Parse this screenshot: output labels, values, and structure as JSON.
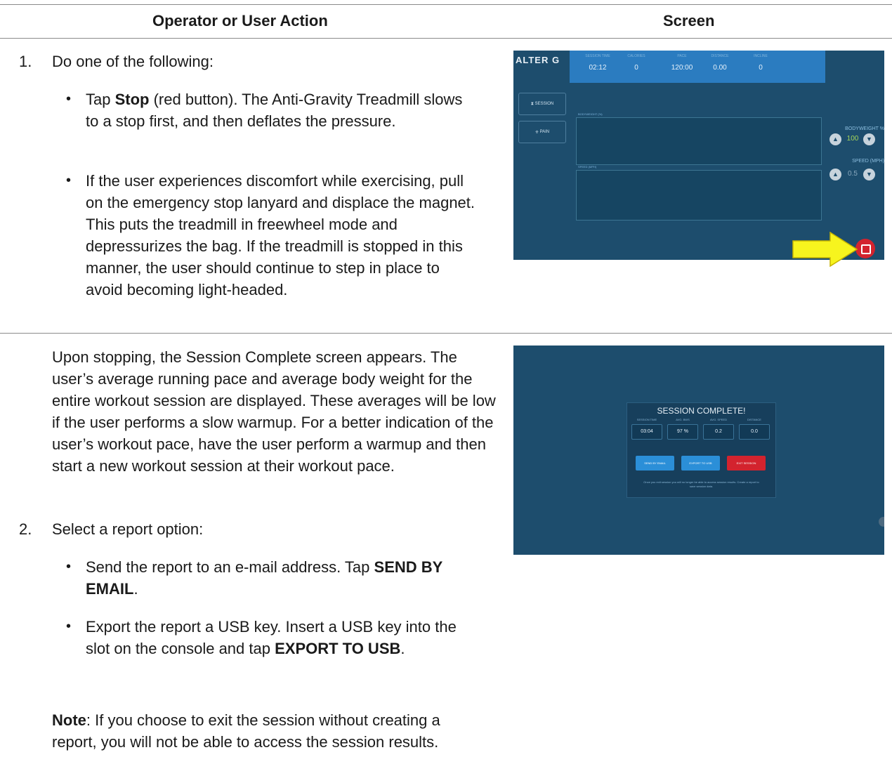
{
  "table": {
    "header_action": "Operator or User Action",
    "header_screen": "Screen"
  },
  "row1": {
    "step_num": "1.",
    "step_text": "Do one of the following:",
    "b1_pre": "Tap ",
    "b1_bold": "Stop",
    "b1_post": " (red button). The Anti-Gravity Treadmill slows to a stop first, and then deflates the pressure.",
    "b2_text": "If the user experiences discomfort while exercising, pull on the emergency stop lanyard and displace the magnet. This puts the treadmill in freewheel mode and depressurizes the bag. If the treadmill is stopped in this manner, the user should continue to step in place to avoid becoming light-headed."
  },
  "row2": {
    "intro": "Upon stopping, the Session Complete screen appears. The user’s average running pace and average body weight for the entire workout session are displayed. These averages will be low if the user performs a slow warmup. For a better indication of the user’s workout pace, have the user perform a warmup and then start a new workout session at their workout pace.",
    "step_num": "2.",
    "step_text": "Select a report option:",
    "b1_pre": "Send the report to an e-mail address. Tap ",
    "b1_bold": "SEND BY EMAIL",
    "b1_post": ".",
    "b2_pre": "Export the report a USB key. Insert a USB key into the slot on the console and tap ",
    "b2_bold": "EXPORT TO USB",
    "b2_post": ".",
    "note_bold": "Note",
    "note_text": ": If you choose to exit the session without creating a report, you will not be able to access the session results."
  },
  "screen1": {
    "logo": "ALTER G",
    "stats": [
      {
        "label": "SESSION TIME",
        "value": "02:12"
      },
      {
        "label": "CALORIES",
        "value": "0"
      },
      {
        "label": "PACE",
        "value": "120:00"
      },
      {
        "label": "DISTANCE",
        "value": "0.00"
      },
      {
        "label": "INCLINE",
        "value": "0"
      }
    ],
    "side_session": "SESSION",
    "side_pain": "PAIN",
    "bodyweight_label": "BODYWEIGHT %",
    "bodyweight_value": "100",
    "speed_label": "SPEED (MPH)",
    "speed_value": "0.5"
  },
  "screen2": {
    "title": "SESSION COMPLETE!",
    "cols": [
      {
        "label": "SESSION TIME",
        "value": "03:04"
      },
      {
        "label": "AVG. BWS",
        "value": "97 %"
      },
      {
        "label": "AVG. SPEED",
        "value": "0.2"
      },
      {
        "label": "DISTANCE",
        "value": "0.0"
      }
    ],
    "btn_email": "SEND BY EMAIL",
    "btn_usb": "EXPORT TO USB",
    "btn_exit": "EXIT SESSION",
    "footer": "Once you exit session you will no longer be able to access session results. Create a report to save session data.",
    "colors": {
      "email": "#2b8fd8",
      "usb": "#2b8fd8",
      "exit": "#d3232e"
    }
  }
}
